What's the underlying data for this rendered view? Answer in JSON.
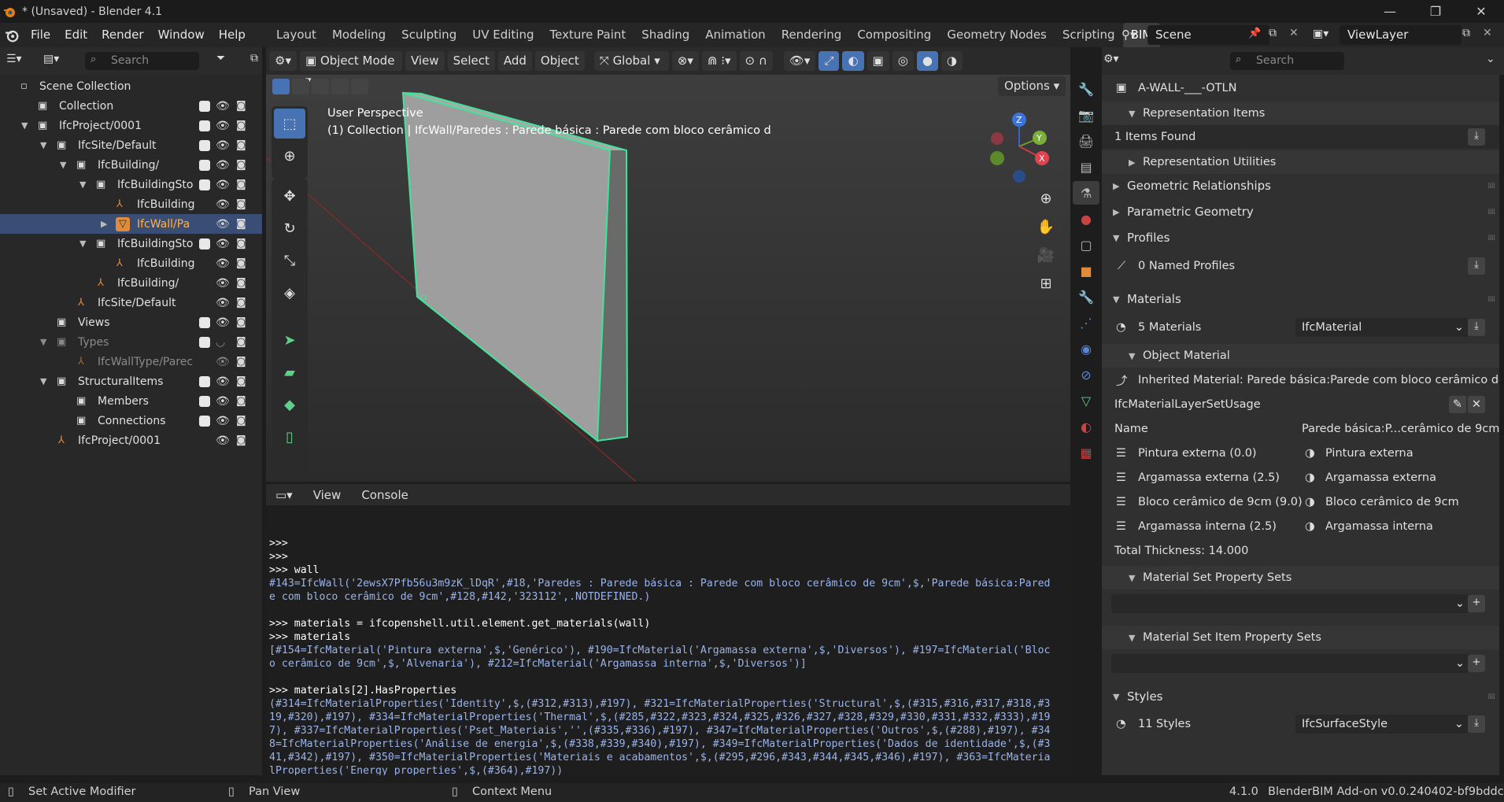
{
  "window": {
    "title": "* (Unsaved) - Blender 4.1"
  },
  "menu": [
    "File",
    "Edit",
    "Render",
    "Window",
    "Help"
  ],
  "workspaces": [
    "Layout",
    "Modeling",
    "Sculpting",
    "UV Editing",
    "Texture Paint",
    "Shading",
    "Animation",
    "Rendering",
    "Compositing",
    "Geometry Nodes",
    "Scripting",
    "BIM"
  ],
  "active_workspace": "BIM",
  "scene": "Scene",
  "view_layer": "ViewLayer",
  "outliner": {
    "search_placeholder": "Search",
    "rows": [
      {
        "label": "Scene Collection"
      },
      {
        "label": "Collection"
      },
      {
        "label": "IfcProject/0001"
      },
      {
        "label": "IfcSite/Default"
      },
      {
        "label": "IfcBuilding/"
      },
      {
        "label": "IfcBuildingStor"
      },
      {
        "label": "IfcBuilding"
      },
      {
        "label": "IfcWall/Pa"
      },
      {
        "label": "IfcBuildingStor"
      },
      {
        "label": "IfcBuilding"
      },
      {
        "label": "IfcBuilding/"
      },
      {
        "label": "IfcSite/Default"
      },
      {
        "label": "Views"
      },
      {
        "label": "Types"
      },
      {
        "label": "IfcWallType/Parec"
      },
      {
        "label": "StructuralItems"
      },
      {
        "label": "Members"
      },
      {
        "label": "Connections"
      },
      {
        "label": "IfcProject/0001"
      }
    ]
  },
  "viewport": {
    "mode": "Object Mode",
    "menus": [
      "View",
      "Select",
      "Add",
      "Object"
    ],
    "orientation": "Global",
    "options": "Options",
    "overlay_title": "User Perspective",
    "overlay_sub": "(1) Collection | IfcWall/Paredes : Parede básica : Parede com bloco cerâmico d"
  },
  "console": {
    "menus": [
      "View",
      "Console"
    ],
    "lines": [
      {
        "t": ">>>",
        "k": "in"
      },
      {
        "t": ">>>",
        "k": "in"
      },
      {
        "t": ">>> wall",
        "k": "in"
      },
      {
        "t": "#143=IfcWall('2ewsX7Pfb56u3m9zK_lDqR',#18,'Paredes : Parede básica : Parede com bloco cerâmico de 9cm',$,'Parede básica:Pared",
        "k": "out"
      },
      {
        "t": "e com bloco cerâmico de 9cm',#128,#142,'323112',.NOTDEFINED.)",
        "k": "out"
      },
      {
        "t": "",
        "k": "in"
      },
      {
        "t": ">>> materials = ifcopenshell.util.element.get_materials(wall)",
        "k": "in"
      },
      {
        "t": ">>> materials",
        "k": "in"
      },
      {
        "t": "[#154=IfcMaterial('Pintura externa',$,'Genérico'), #190=IfcMaterial('Argamassa externa',$,'Diversos'), #197=IfcMaterial('Bloc",
        "k": "out"
      },
      {
        "t": "o cerâmico de 9cm',$,'Alvenaria'), #212=IfcMaterial('Argamassa interna',$,'Diversos')]",
        "k": "out"
      },
      {
        "t": "",
        "k": "in"
      },
      {
        "t": ">>> materials[2].HasProperties",
        "k": "in"
      },
      {
        "t": "(#314=IfcMaterialProperties('Identity',$,(#312,#313),#197), #321=IfcMaterialProperties('Structural',$,(#315,#316,#317,#318,#3",
        "k": "out"
      },
      {
        "t": "19,#320),#197), #334=IfcMaterialProperties('Thermal',$,(#285,#322,#323,#324,#325,#326,#327,#328,#329,#330,#331,#332,#333),#19",
        "k": "out"
      },
      {
        "t": "7), #337=IfcMaterialProperties('Pset_Materiais','',(#335,#336),#197), #347=IfcMaterialProperties('Outros',$,(#288),#197), #34",
        "k": "out"
      },
      {
        "t": "8=IfcMaterialProperties('Análise de energia',$,(#338,#339,#340),#197), #349=IfcMaterialProperties('Dados de identidade',$,(#3",
        "k": "out"
      },
      {
        "t": "41,#342),#197), #350=IfcMaterialProperties('Materiais e acabamentos',$,(#295,#296,#343,#344,#345,#346),#197), #363=IfcMateria",
        "k": "out"
      },
      {
        "t": "lProperties('Energy_properties',$,(#364),#197))",
        "k": "out"
      }
    ],
    "prompt": ">>>"
  },
  "properties": {
    "search_placeholder": "Search",
    "top_item": "A-WALL-___-OTLN",
    "representation_items": "Representation Items",
    "items_found": "1 Items Found",
    "representation_utilities": "Representation Utilities",
    "geometric_relationships": "Geometric Relationships",
    "parametric_geometry": "Parametric Geometry",
    "profiles": "Profiles",
    "named_profiles": "0 Named Profiles",
    "materials": "Materials",
    "materials_count": "5 Materials",
    "materials_type": "IfcMaterial",
    "object_material": "Object Material",
    "inherited": "Inherited Material: Parede básica:Parede com bloco cerâmico de ...",
    "usage": "IfcMaterialLayerSetUsage",
    "name_label": "Name",
    "name_value": "Parede básica:P...cerâmico de 9cm",
    "layers": [
      {
        "layer": "Pintura externa (0.0)",
        "material": "Pintura externa"
      },
      {
        "layer": "Argamassa externa (2.5)",
        "material": "Argamassa externa"
      },
      {
        "layer": "Bloco cerâmico de 9cm (9.0)",
        "material": "Bloco cerâmico de 9cm"
      },
      {
        "layer": "Argamassa interna (2.5)",
        "material": "Argamassa interna"
      }
    ],
    "total_thickness": "Total Thickness: 14.000",
    "set_psets": "Material Set Property Sets",
    "item_psets": "Material Set Item Property Sets",
    "styles": "Styles",
    "styles_count": "11 Styles",
    "styles_type": "IfcSurfaceStyle"
  },
  "status": {
    "left1": "Set Active Modifier",
    "left2": "Pan View",
    "left3": "Context Menu",
    "version": "4.1.0",
    "addon": "BlenderBIM Add-on v0.0.240402-bf9bddc"
  }
}
